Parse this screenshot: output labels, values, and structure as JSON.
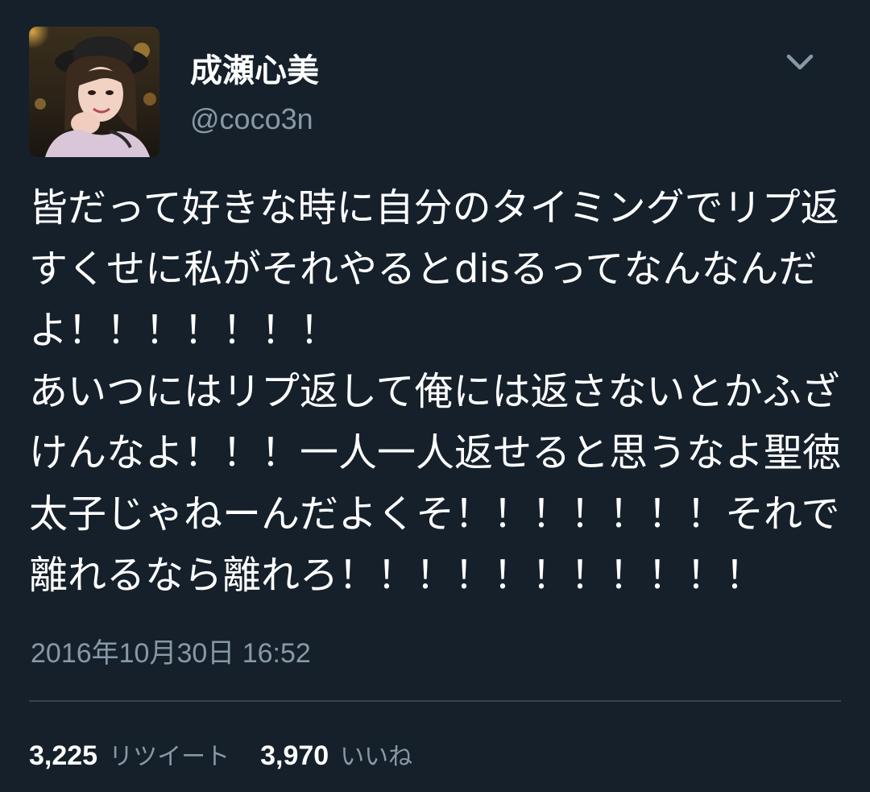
{
  "user": {
    "display_name": "成瀬心美",
    "handle": "@coco3n",
    "avatar_icon": "profile-photo"
  },
  "menu": {
    "icon": "chevron-down-icon"
  },
  "tweet": {
    "text": "皆だって好きな時に自分のタイミングでリプ返すくせに私がそれやるとdisるってなんなんだよ！！！！！！！\nあいつにはリプ返して俺には返さないとかふざけんなよ！！！一人一人返せると思うなよ聖徳太子じゃねーんだよくそ！！！！！！！それで離れるなら離れろ！！！！！！！！！！！",
    "timestamp": "2016年10月30日 16:52"
  },
  "stats": {
    "retweets_count": "3,225",
    "retweets_label": "リツイート",
    "likes_count": "3,970",
    "likes_label": "いいね"
  },
  "colors": {
    "background": "#15202b",
    "primary_text": "#ffffff",
    "secondary_text": "#8899a6",
    "divider": "#38444d"
  }
}
